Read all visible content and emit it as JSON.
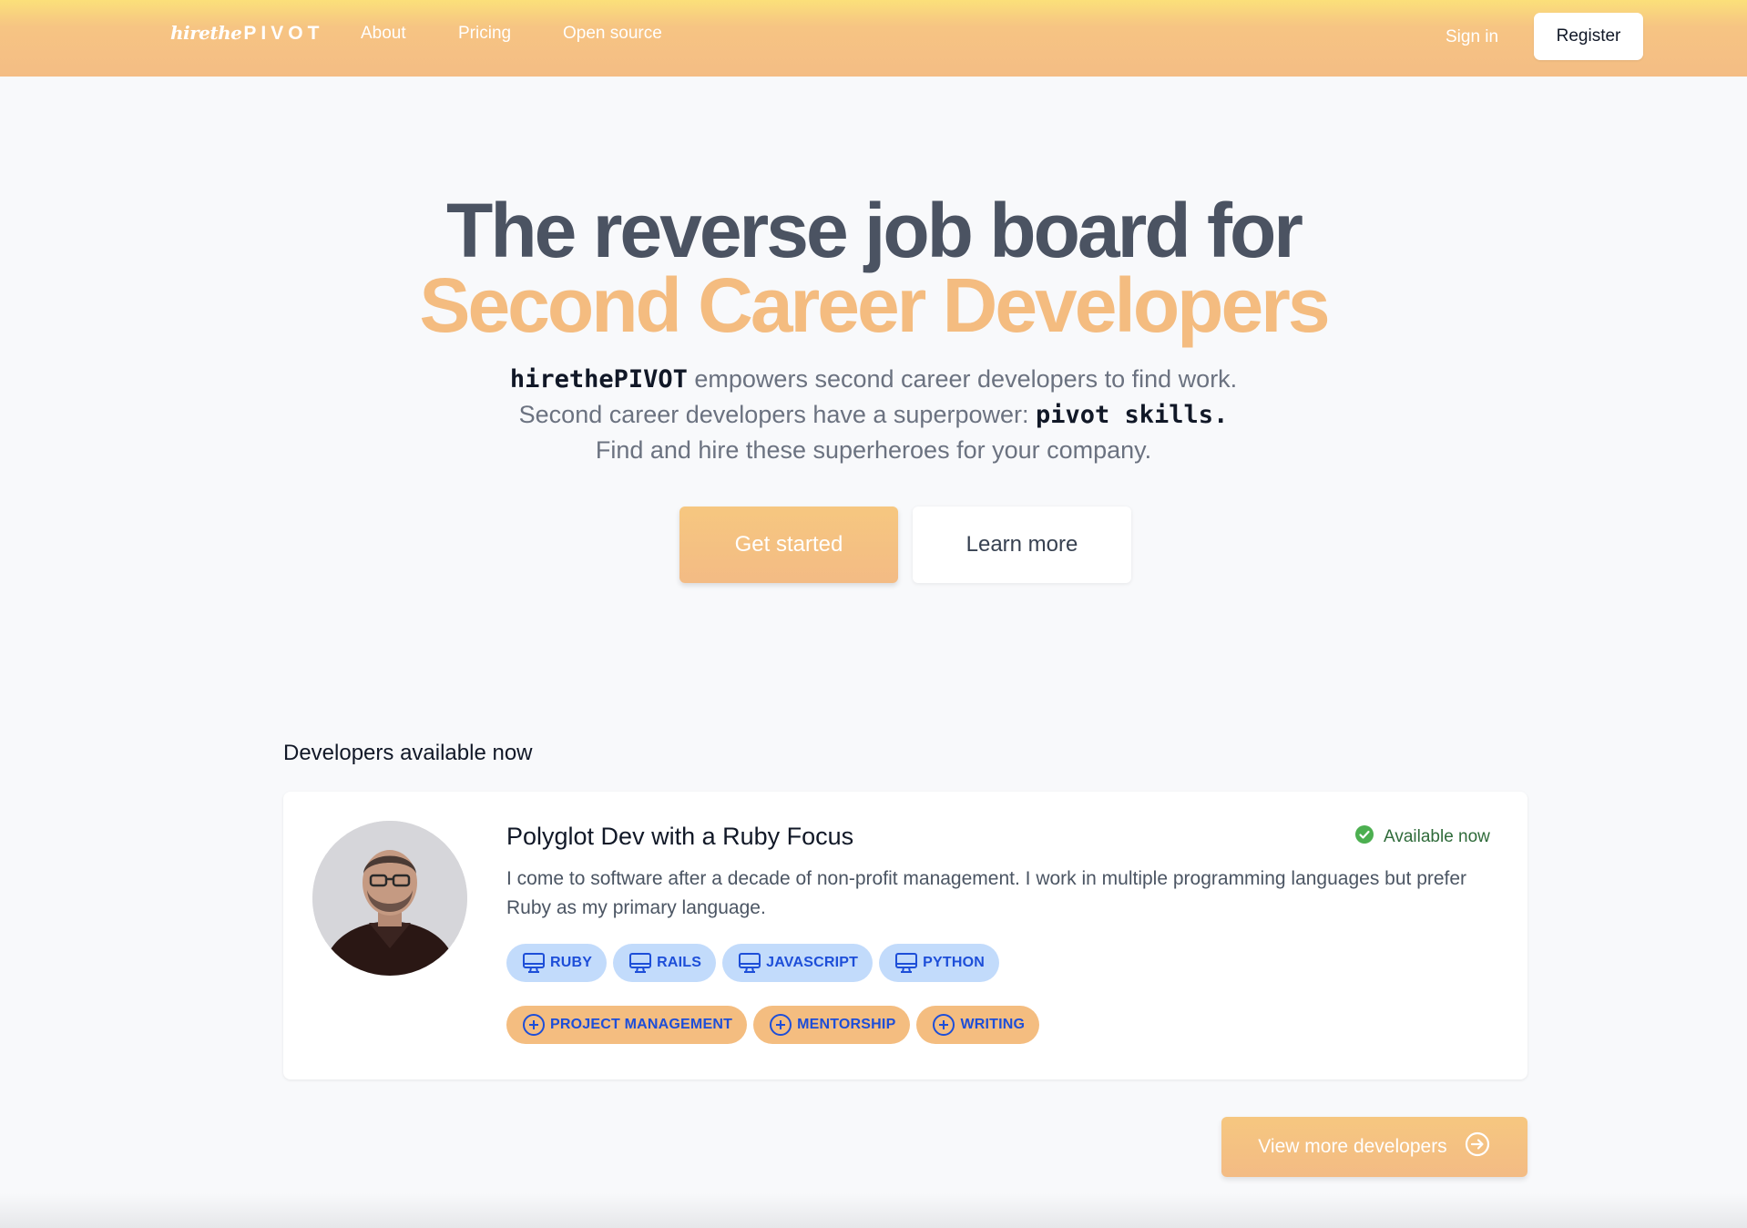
{
  "nav": {
    "logo_part1": "hirethe",
    "logo_part2": "PIVOT",
    "links": [
      "About",
      "Pricing",
      "Open source"
    ],
    "sign_in": "Sign in",
    "register": "Register"
  },
  "hero": {
    "title_line1": "The reverse job board for",
    "title_line2": "Second Career Developers",
    "sub1_mono": "hirethePIVOT",
    "sub1_rest": " empowers second career developers to find work.",
    "sub2_text": "Second career developers have a superpower: ",
    "sub2_mono": "pivot skills.",
    "sub3": "Find and hire these superheroes for your company.",
    "get_started": "Get started",
    "learn_more": "Learn more"
  },
  "developers": {
    "heading": "Developers available now",
    "card": {
      "title": "Polyglot Dev with a Ruby Focus",
      "status": "Available now",
      "description": "I come to software after a decade of non-profit management. I work in multiple programming languages but prefer Ruby as my primary language.",
      "languages": [
        "RUBY",
        "RAILS",
        "JAVASCRIPT",
        "PYTHON"
      ],
      "skills": [
        "PROJECT MANAGEMENT",
        "MENTORSHIP",
        "WRITING"
      ]
    },
    "view_more": "View more developers"
  },
  "colors": {
    "accent": "#f4bc80",
    "nav_top": "#fbe07a",
    "tag_lang_bg": "#c2dbfb",
    "tag_text": "#1d4ed8",
    "available_green": "#4caf50"
  },
  "icons": {
    "language_tag": "monitor-icon",
    "skill_tag": "plus-circle-icon",
    "status": "check-circle-icon",
    "view_more": "arrow-right-circle-icon"
  }
}
